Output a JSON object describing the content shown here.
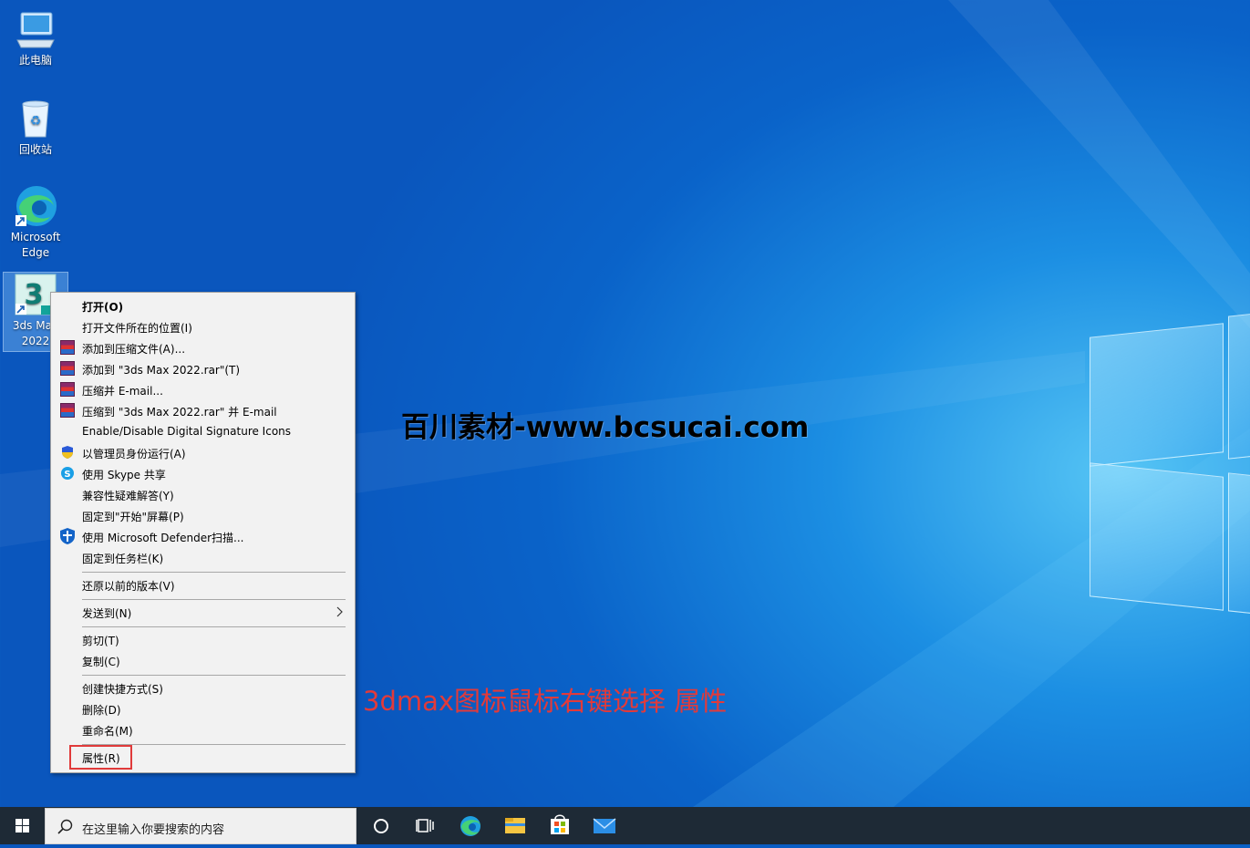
{
  "desktop": {
    "icons": [
      {
        "label": "此电脑"
      },
      {
        "label": "回收站"
      },
      {
        "label": "Microsoft Edge"
      },
      {
        "label": "3ds Max 2022"
      }
    ],
    "watermark": "百川素材-www.bcsucai.com",
    "annotation": "3dmax图标鼠标右键选择 属性",
    "annotation_color": "#e23a3a"
  },
  "context_menu": {
    "items": [
      {
        "label": "打开(O)",
        "icon": ""
      },
      {
        "label": "打开文件所在的位置(I)",
        "icon": ""
      },
      {
        "label": "添加到压缩文件(A)...",
        "icon": "winrar-icon"
      },
      {
        "label": "添加到 \"3ds Max 2022.rar\"(T)",
        "icon": "winrar-icon"
      },
      {
        "label": "压缩并 E-mail...",
        "icon": "winrar-icon"
      },
      {
        "label": "压缩到 \"3ds Max 2022.rar\" 并 E-mail",
        "icon": "winrar-icon"
      },
      {
        "label": "Enable/Disable Digital Signature Icons",
        "icon": ""
      },
      {
        "label": "以管理员身份运行(A)",
        "icon": "uac-shield-icon"
      },
      {
        "label": "使用 Skype 共享",
        "icon": "skype-icon"
      },
      {
        "label": "兼容性疑难解答(Y)",
        "icon": ""
      },
      {
        "label": "固定到\"开始\"屏幕(P)",
        "icon": ""
      },
      {
        "label": "使用 Microsoft Defender扫描...",
        "icon": "defender-icon"
      },
      {
        "label": "固定到任务栏(K)",
        "icon": ""
      },
      {
        "label": "还原以前的版本(V)",
        "icon": ""
      },
      {
        "label": "发送到(N)",
        "icon": ""
      },
      {
        "label": "剪切(T)",
        "icon": ""
      },
      {
        "label": "复制(C)",
        "icon": ""
      },
      {
        "label": "创建快捷方式(S)",
        "icon": ""
      },
      {
        "label": "删除(D)",
        "icon": ""
      },
      {
        "label": "重命名(M)",
        "icon": ""
      },
      {
        "label": "属性(R)",
        "icon": ""
      }
    ]
  },
  "taskbar": {
    "search_placeholder": "在这里输入你要搜索的内容",
    "apps": [
      "cortana-icon",
      "task-view-icon",
      "edge-icon",
      "file-explorer-icon",
      "store-icon",
      "mail-icon"
    ]
  }
}
